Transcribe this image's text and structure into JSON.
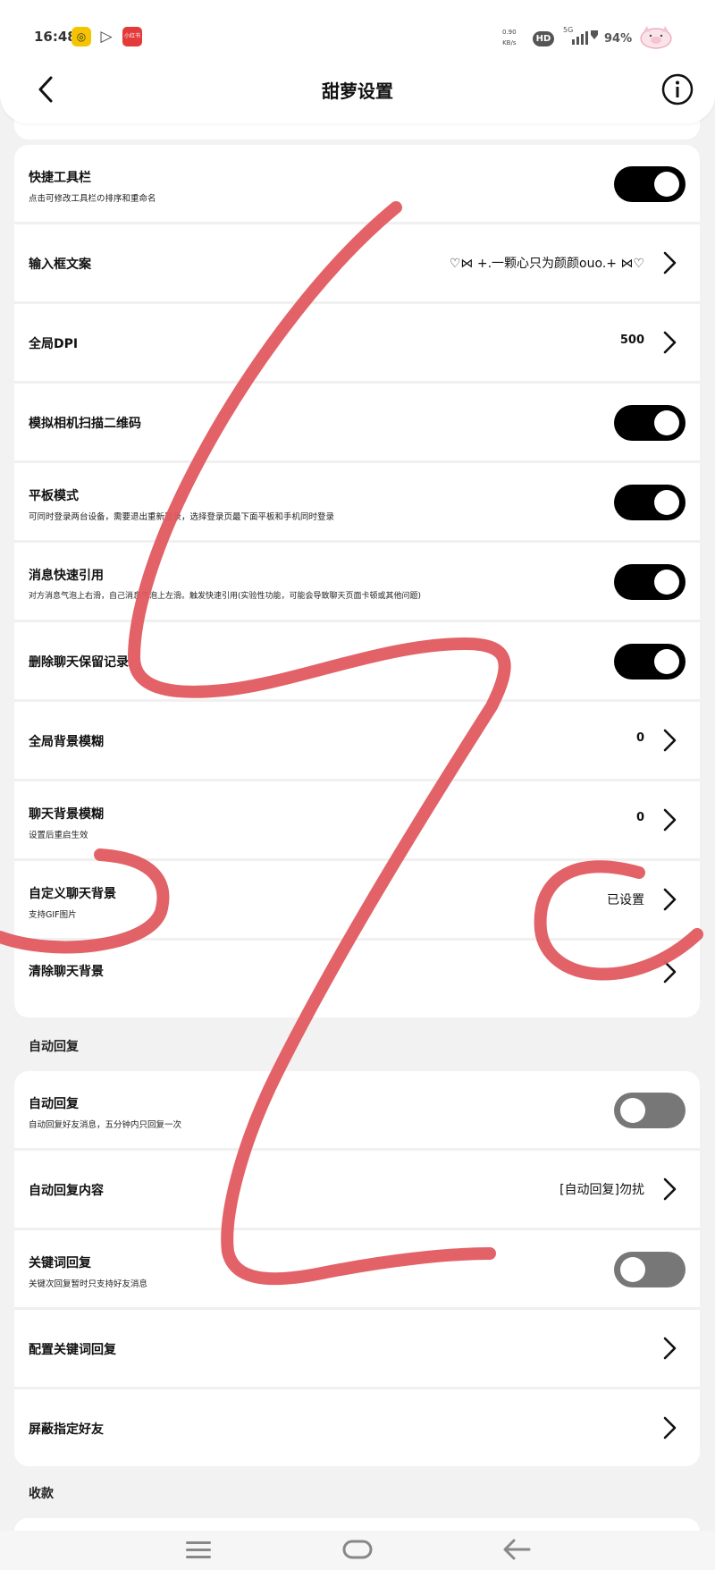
{
  "status": {
    "time": "16:48",
    "speed_top": "0.90",
    "speed_bottom": "KB/s",
    "hd": "HD",
    "net": "5G",
    "battery": "94%",
    "app3_label": "小红书"
  },
  "header": {
    "title": "甜萝设置"
  },
  "card1": [
    {
      "title": "快捷工具栏",
      "sub": "点击可修改工具栏の排序和重命名",
      "control": "toggle",
      "state": "on"
    },
    {
      "title": "输入框文案",
      "value": "♡⋈ +.一颗心只为颜颜ouo.+ ⋈♡",
      "control": "chevron"
    },
    {
      "title": "全局DPI",
      "value": "500",
      "control": "chevron"
    },
    {
      "title": "模拟相机扫描二维码",
      "control": "toggle",
      "state": "on"
    },
    {
      "title": "平板模式",
      "sub": "可同时登录两台设备，需要退出重新登录，选择登录页最下面平板和手机同时登录",
      "control": "toggle",
      "state": "on"
    },
    {
      "title": "消息快速引用",
      "sub": "对方消息气泡上右滑，自己消息气泡上左滑。触发快速引用(实验性功能，可能会导致聊天页面卡顿或其他问题)",
      "control": "toggle",
      "state": "on"
    },
    {
      "title": "删除聊天保留记录",
      "control": "toggle",
      "state": "on"
    },
    {
      "title": "全局背景模糊",
      "value": "0",
      "control": "chevron"
    },
    {
      "title": "聊天背景模糊",
      "sub": "设置后重启生效",
      "value": "0",
      "control": "chevron"
    },
    {
      "title": "自定义聊天背景",
      "sub": "支持GIF图片",
      "value": "已设置",
      "control": "chevron"
    },
    {
      "title": "清除聊天背景",
      "control": "chevron"
    }
  ],
  "section_auto_reply": "自动回复",
  "card2": [
    {
      "title": "自动回复",
      "sub": "自动回复好友消息，五分钟内只回复一次",
      "control": "toggle",
      "state": "off"
    },
    {
      "title": "自动回复内容",
      "value": "[自动回复]勿扰",
      "control": "chevron"
    },
    {
      "title": "关键词回复",
      "sub": "关键次回复暂时只支持好友消息",
      "control": "toggle",
      "state": "off"
    },
    {
      "title": "配置关键词回复",
      "control": "chevron"
    },
    {
      "title": "屏蔽指定好友",
      "control": "chevron"
    }
  ],
  "section_payment": "收款",
  "icons": {
    "back": "back-arrow-icon",
    "info": "info-icon",
    "chevron": "chevron-right-icon",
    "nav_menu": "menu-icon",
    "nav_home": "home-icon",
    "nav_back": "back-icon"
  },
  "colors": {
    "toggle_on": "#000000",
    "toggle_off": "#777777",
    "scribble": "#e05a5f"
  }
}
